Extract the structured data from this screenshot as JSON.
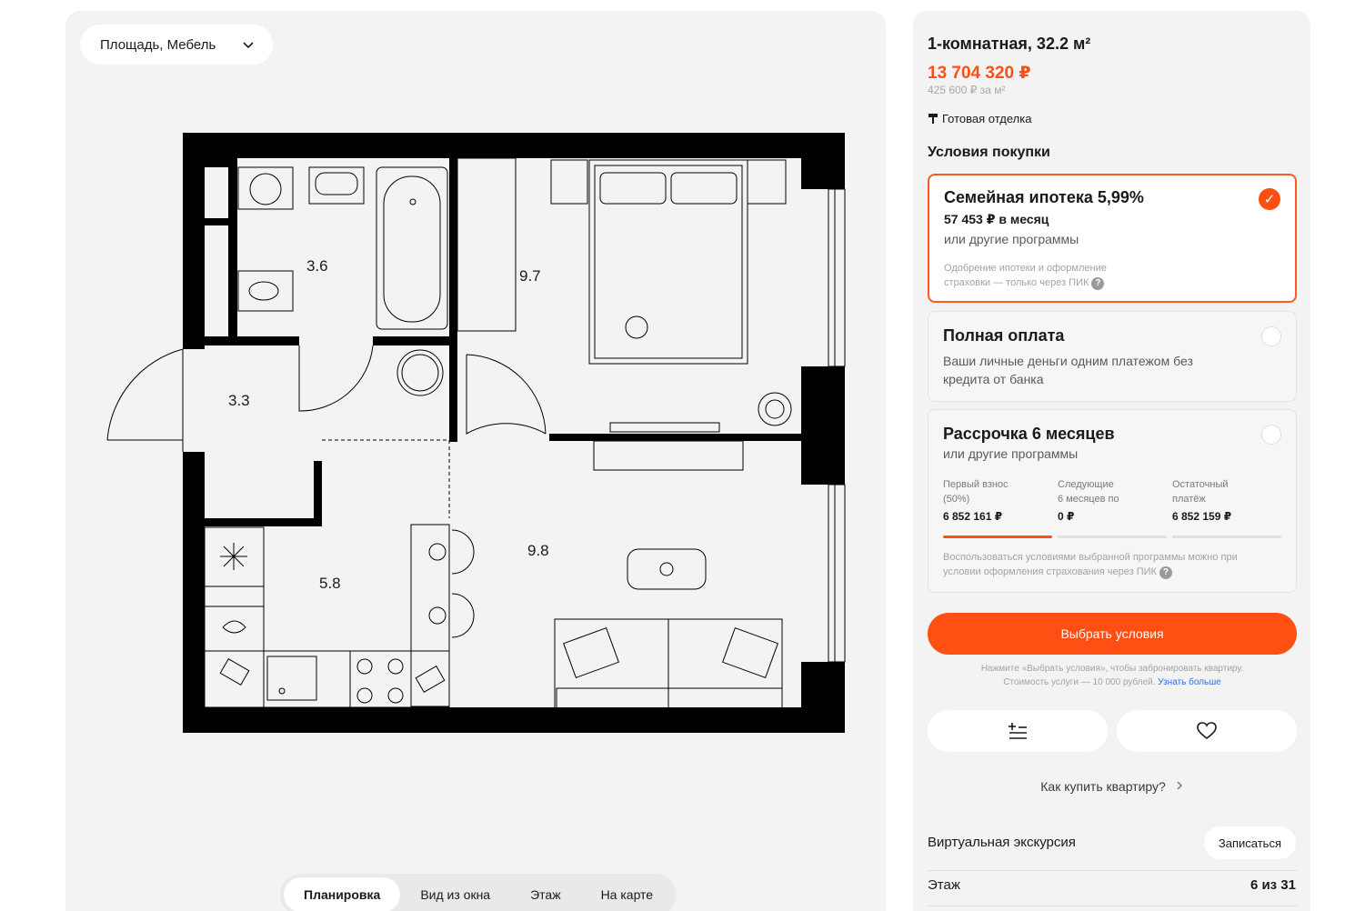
{
  "filter": {
    "label": "Площадь, Мебель"
  },
  "plan": {
    "rooms": [
      {
        "key": "bath",
        "area": "3.6"
      },
      {
        "key": "bedroom",
        "area": "9.7"
      },
      {
        "key": "hall",
        "area": "3.3"
      },
      {
        "key": "kitchen",
        "area": "5.8"
      },
      {
        "key": "living",
        "area": "9.8"
      }
    ]
  },
  "view_tabs": [
    {
      "label": "Планировка",
      "active": true
    },
    {
      "label": "Вид из окна",
      "active": false
    },
    {
      "label": "Этаж",
      "active": false
    },
    {
      "label": "На карте",
      "active": false
    }
  ],
  "apartment": {
    "title": "1-комнатная, 32.2 м²",
    "price": "13 704 320 ₽",
    "price_per_m2": "425 600 ₽ за м²",
    "finish": "Готовая отделка"
  },
  "conditions": {
    "heading": "Условия покупки",
    "family": {
      "title": "Семейная ипотека 5,99%",
      "monthly": "57 453 ₽ в месяц",
      "other": "или другие программы",
      "note_line1": "Одобрение ипотеки и оформление",
      "note_line2": "страховки — только через ПИК",
      "selected": true
    },
    "full": {
      "title": "Полная оплата",
      "desc_line1": "Ваши личные деньги одним платежом без",
      "desc_line2": "кредита от банка"
    },
    "installment": {
      "title": "Рассрочка 6 месяцев",
      "other": "или другие программы",
      "cols": [
        {
          "label_line1": "Первый взнос",
          "label_line2": "(50%)",
          "value": "6 852 161 ₽",
          "active": true
        },
        {
          "label_line1": "Следующие",
          "label_line2": "6 месяцев по",
          "value": "0 ₽",
          "active": false
        },
        {
          "label_line1": "Остаточный",
          "label_line2": "платёж",
          "value": "6 852 159 ₽",
          "active": false
        }
      ],
      "note_line1": "Воспользоваться условиями выбранной программы можно при",
      "note_line2": "условии оформления страхования через ПИК"
    }
  },
  "cta": {
    "label": "Выбрать условия",
    "note_line1": "Нажмите «Выбрать условия», чтобы забронировать квартиру.",
    "note_line2": "Стоимость услуги — 10 000 рублей.",
    "note_link": "Узнать больше"
  },
  "how_to_buy": "Как купить квартиру?",
  "tour": {
    "label": "Виртуальная экскурсия",
    "button": "Записаться"
  },
  "floor": {
    "label": "Этаж",
    "value": "6 из 31"
  },
  "colors": {
    "accent": "#ff4f12",
    "panel": "#f3f3f3"
  },
  "icons": [
    "chevron-down-icon",
    "paint-roller-icon",
    "check-icon",
    "help-icon",
    "compare-icon",
    "heart-icon",
    "chevron-right-icon"
  ]
}
